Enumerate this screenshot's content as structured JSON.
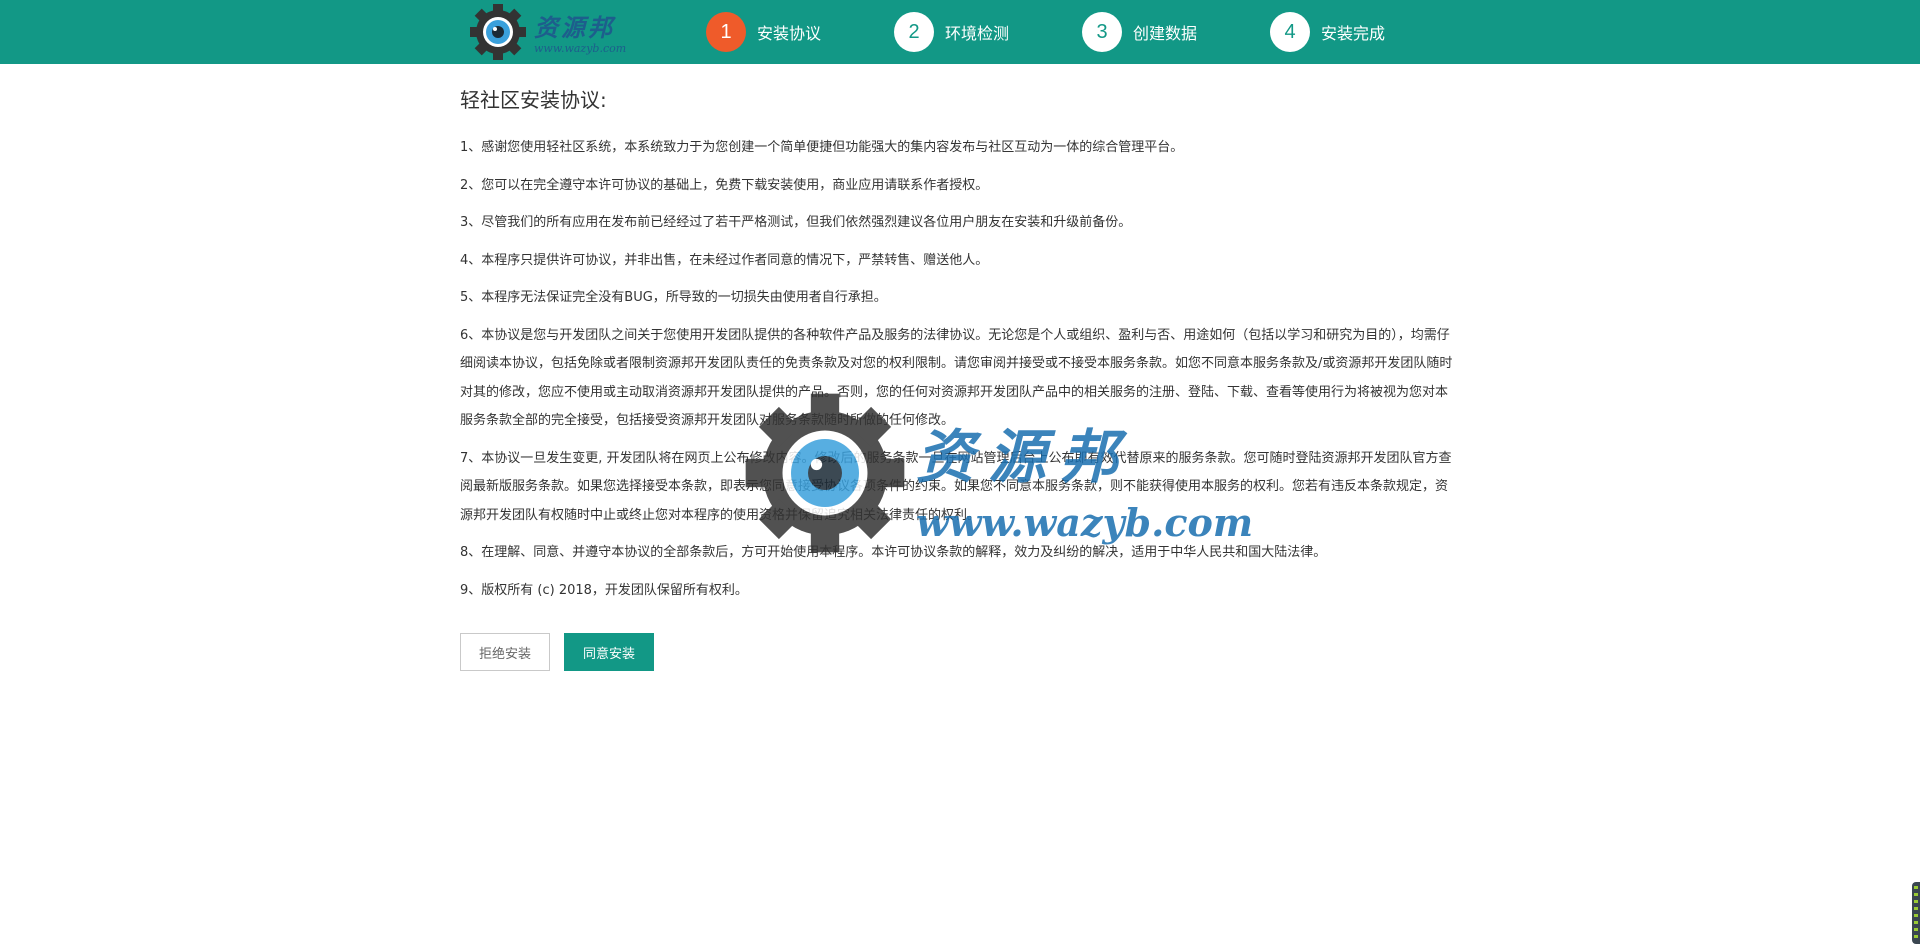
{
  "header": {
    "logo": {
      "text": "资源邦",
      "url": "www.wazyb.com"
    },
    "steps": [
      {
        "num": "1",
        "label": "安装协议",
        "active": true
      },
      {
        "num": "2",
        "label": "环境检测",
        "active": false
      },
      {
        "num": "3",
        "label": "创建数据",
        "active": false
      },
      {
        "num": "4",
        "label": "安装完成",
        "active": false
      }
    ],
    "colors": {
      "bar": "#129886",
      "active_step": "#ef5b2a"
    }
  },
  "main": {
    "title": "轻社区安装协议:",
    "clauses": [
      "1、感谢您使用轻社区系统，本系统致力于为您创建一个简单便捷但功能强大的集内容发布与社区互动为一体的综合管理平台。",
      "2、您可以在完全遵守本许可协议的基础上，免费下载安装使用，商业应用请联系作者授权。",
      "3、尽管我们的所有应用在发布前已经经过了若干严格测试，但我们依然强烈建议各位用户朋友在安装和升级前备份。",
      "4、本程序只提供许可协议，并非出售，在未经过作者同意的情况下，严禁转售、赠送他人。",
      "5、本程序无法保证完全没有BUG，所导致的一切损失由使用者自行承担。",
      "6、本协议是您与开发团队之间关于您使用开发团队提供的各种软件产品及服务的法律协议。无论您是个人或组织、盈利与否、用途如何（包括以学习和研究为目的），均需仔细阅读本协议，包括免除或者限制资源邦开发团队责任的免责条款及对您的权利限制。请您审阅并接受或不接受本服务条款。如您不同意本服务条款及/或资源邦开发团队随时对其的修改，您应不使用或主动取消资源邦开发团队提供的产品。否则，您的任何对资源邦开发团队产品中的相关服务的注册、登陆、下载、查看等使用行为将被视为您对本服务条款全部的完全接受，包括接受资源邦开发团队对服务条款随时所做的任何修改。",
      "7、本协议一旦发生变更, 开发团队将在网页上公布修改内容。修改后的服务条款一旦在网站管理后台上公布即有效代替原来的服务条款。您可随时登陆资源邦开发团队官方查阅最新版服务条款。如果您选择接受本条款，即表示您同意接受协议各项条件的约束。如果您不同意本服务条款，则不能获得使用本服务的权利。您若有违反本条款规定，资源邦开发团队有权随时中止或终止您对本程序的使用资格并保留追究相关法律责任的权利。",
      "8、在理解、同意、并遵守本协议的全部条款后，方可开始使用本程序。本许可协议条款的解释，效力及纠纷的解决，适用于中华人民共和国大陆法律。",
      "9、版权所有 (c) 2018，开发团队保留所有权利。"
    ]
  },
  "actions": {
    "reject_label": "拒绝安装",
    "accept_label": "同意安装"
  },
  "watermark": {
    "text": "资源邦",
    "url": "www.wazyb.com"
  }
}
